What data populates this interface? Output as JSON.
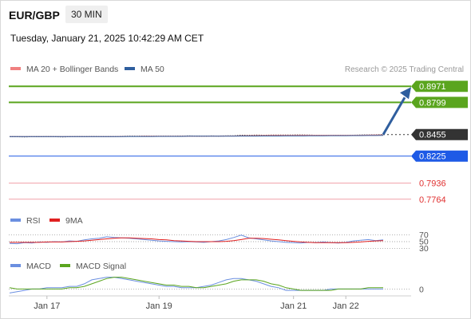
{
  "header": {
    "symbol": "EUR/GBP",
    "interval": "30 MIN",
    "timestamp": "Tuesday, January 21, 2025 10:42:29 AM CET"
  },
  "colors": {
    "ma20": "#f08080",
    "ma50": "#2f5e9e",
    "price": "#333333",
    "green": "#5aa51e",
    "blue": "#1e5ae6",
    "red": "#f0a0a8",
    "rsi": "#6b8fe0",
    "ma9": "#e02020",
    "macd": "#6b8fe0",
    "signal": "#5aa51e",
    "arrow": "#2f5e9e"
  },
  "chart_data": [
    {
      "type": "line",
      "legend": [
        {
          "name": "MA 20 + Bollinger Bands",
          "key": "ma20"
        },
        {
          "name": "MA 50",
          "key": "ma50"
        }
      ],
      "source": "Research © 2025 Trading Central",
      "ylim": [
        0.7694,
        0.9041
      ],
      "current_price": 0.8455,
      "levels": [
        {
          "label": "0.8971",
          "value": 0.8971,
          "type": "resistance"
        },
        {
          "label": "0.8799",
          "value": 0.8799,
          "type": "resistance"
        },
        {
          "label": "0.8455",
          "value": 0.8455,
          "type": "current"
        },
        {
          "label": "0.8225",
          "value": 0.8225,
          "type": "pivot"
        },
        {
          "label": "0.7936",
          "value": 0.7936,
          "type": "support"
        },
        {
          "label": "0.7764",
          "value": 0.7764,
          "type": "support"
        }
      ],
      "forecast_arrow": {
        "from": 0.8455,
        "to": 0.8971
      },
      "series": [
        {
          "key": "price",
          "values": [
            0.8432,
            0.8432,
            0.8431,
            0.8433,
            0.8432,
            0.8434,
            0.8433,
            0.8431,
            0.8432,
            0.8434,
            0.8433,
            0.8435,
            0.8434,
            0.8433,
            0.8434,
            0.8436,
            0.8438,
            0.8437,
            0.8439,
            0.8438,
            0.8437,
            0.8438,
            0.8438,
            0.8439,
            0.844,
            0.8439,
            0.8438,
            0.844,
            0.8439,
            0.8441,
            0.8442,
            0.8448,
            0.8447,
            0.8449,
            0.8448,
            0.8449,
            0.845,
            0.8449,
            0.845,
            0.8451,
            0.8449,
            0.8448,
            0.8447,
            0.8447,
            0.8448,
            0.8447,
            0.8448,
            0.845,
            0.8451,
            0.8452,
            0.8455
          ]
        },
        {
          "key": "ma20",
          "values": [
            0.8433,
            0.8433,
            0.8433,
            0.8433,
            0.8433,
            0.8433,
            0.8433,
            0.8433,
            0.8433,
            0.8433,
            0.8433,
            0.8434,
            0.8434,
            0.8434,
            0.8434,
            0.8435,
            0.8436,
            0.8436,
            0.8437,
            0.8437,
            0.8437,
            0.8437,
            0.8438,
            0.8438,
            0.8438,
            0.8438,
            0.8438,
            0.8439,
            0.8439,
            0.844,
            0.844,
            0.8442,
            0.8443,
            0.8444,
            0.8445,
            0.8446,
            0.8446,
            0.8447,
            0.8447,
            0.8448,
            0.8448,
            0.8448,
            0.8448,
            0.8448,
            0.8448,
            0.8448,
            0.8448,
            0.8448,
            0.8449,
            0.845,
            0.8451
          ]
        },
        {
          "key": "ma50",
          "values": [
            0.8434,
            0.8434,
            0.8434,
            0.8434,
            0.8434,
            0.8434,
            0.8434,
            0.8434,
            0.8434,
            0.8434,
            0.8434,
            0.8434,
            0.8434,
            0.8434,
            0.8434,
            0.8434,
            0.8435,
            0.8435,
            0.8435,
            0.8435,
            0.8436,
            0.8436,
            0.8436,
            0.8436,
            0.8437,
            0.8437,
            0.8437,
            0.8437,
            0.8438,
            0.8438,
            0.8438,
            0.8439,
            0.8439,
            0.8439,
            0.844,
            0.844,
            0.844,
            0.8441,
            0.8441,
            0.8441,
            0.8442,
            0.8442,
            0.8442,
            0.8443,
            0.8443,
            0.8443,
            0.8444,
            0.8444,
            0.8445,
            0.8445,
            0.8446
          ]
        }
      ]
    },
    {
      "type": "line",
      "legend": [
        {
          "name": "RSI",
          "key": "rsi"
        },
        {
          "name": "9MA",
          "key": "ma9"
        }
      ],
      "ylim": [
        20,
        80
      ],
      "guides": [
        {
          "label": "70",
          "value": 70
        },
        {
          "label": "50",
          "value": 50
        },
        {
          "label": "30",
          "value": 30
        }
      ],
      "series": [
        {
          "key": "rsi",
          "values": [
            45,
            44,
            47,
            46,
            49,
            48,
            50,
            49,
            52,
            51,
            55,
            58,
            60,
            64,
            62,
            61,
            60,
            58,
            56,
            54,
            52,
            51,
            50,
            49,
            50,
            49,
            48,
            50,
            52,
            56,
            62,
            69,
            61,
            58,
            55,
            52,
            50,
            48,
            47,
            46,
            48,
            47,
            49,
            47,
            46,
            48,
            52,
            54,
            56,
            53,
            55
          ]
        },
        {
          "key": "ma9",
          "values": [
            48,
            48,
            48,
            48,
            48,
            49,
            49,
            49,
            50,
            51,
            52,
            54,
            56,
            58,
            60,
            61,
            61,
            60,
            59,
            58,
            56,
            55,
            53,
            52,
            51,
            50,
            50,
            50,
            50,
            51,
            53,
            56,
            60,
            60,
            59,
            57,
            55,
            53,
            51,
            49,
            48,
            47,
            47,
            47,
            47,
            47,
            48,
            49,
            51,
            52,
            53
          ]
        }
      ]
    },
    {
      "type": "line",
      "legend": [
        {
          "name": "MACD",
          "key": "macd"
        },
        {
          "name": "MACD Signal",
          "key": "signal"
        }
      ],
      "ylim": [
        -0.0004,
        0.001
      ],
      "guides": [
        {
          "label": "0",
          "value": 0
        }
      ],
      "series": [
        {
          "key": "macd",
          "values": [
            -0.0003,
            -0.0002,
            -0.0001,
            0,
            0,
            0.0001,
            0.0001,
            0.0001,
            0.0002,
            0.0002,
            0.0004,
            0.0007,
            0.0008,
            0.0009,
            0.0009,
            0.0008,
            0.0007,
            0.0006,
            0.0005,
            0.0004,
            0.0003,
            0.0002,
            0.0002,
            0.0001,
            0.0001,
            0.0001,
            0.0002,
            0.0003,
            0.0005,
            0.0007,
            0.0008,
            0.0008,
            0.0007,
            0.0006,
            0.0004,
            0.0002,
            0.0001,
            -0.0001,
            -0.0001,
            -0.0001,
            -0.0001,
            -0.0001,
            -0.0001,
            0,
            0,
            0,
            0,
            0,
            0,
            0,
            0
          ]
        },
        {
          "key": "signal",
          "values": [
            0.0001,
            0,
            0,
            0,
            0,
            0,
            0,
            0,
            0.0001,
            0.0001,
            0.0002,
            0.0004,
            0.0006,
            0.0008,
            0.0009,
            0.0009,
            0.0008,
            0.0007,
            0.0006,
            0.0005,
            0.0004,
            0.0003,
            0.0003,
            0.0002,
            0.0002,
            0.0001,
            0.0001,
            0.0002,
            0.0003,
            0.0004,
            0.0006,
            0.0007,
            0.0007,
            0.0007,
            0.0006,
            0.0004,
            0.0003,
            0.0001,
            0,
            -0.0001,
            -0.0001,
            -0.0001,
            -0.0001,
            -0.0001,
            0,
            0,
            0,
            0,
            0.0001,
            0.0001,
            0.0001
          ]
        }
      ]
    }
  ],
  "x_axis": {
    "points": 51,
    "ticks": [
      {
        "label": "Jan 17",
        "index": 5
      },
      {
        "label": "Jan 19",
        "index": 20
      },
      {
        "label": "Jan 21",
        "index": 38
      },
      {
        "label": "Jan 22",
        "index": 45
      }
    ]
  }
}
